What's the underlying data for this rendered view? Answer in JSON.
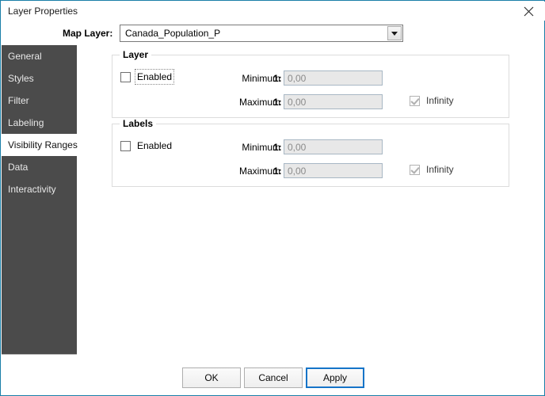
{
  "window": {
    "title": "Layer Properties",
    "close_icon": "close-icon",
    "border_color": "#1a7fa8"
  },
  "map_layer": {
    "label": "Map Layer:",
    "value": "Canada_Population_P",
    "placeholder": "Canada_Population_P",
    "dropdown_icon": "chevron-down-icon"
  },
  "sidebar": {
    "background_color": "#4b4b4b",
    "selected": "Visibility Ranges",
    "items": [
      {
        "label": "General",
        "selected": false
      },
      {
        "label": "Styles",
        "selected": false
      },
      {
        "label": "Filter",
        "selected": false
      },
      {
        "label": "Labeling",
        "selected": false
      },
      {
        "label": "Visibility Ranges",
        "selected": true
      },
      {
        "label": "Data",
        "selected": false
      },
      {
        "label": "Interactivity",
        "selected": false
      }
    ]
  },
  "groups": {
    "layer": {
      "title": "Layer",
      "enabled": {
        "label": "Enabled",
        "checked": false,
        "focused": true
      },
      "minimum": {
        "label": "Minimum",
        "prefix": "1:",
        "value": "0,00",
        "placeholder": "0,00",
        "disabled": true
      },
      "maximum": {
        "label": "Maximum",
        "prefix": "1:",
        "value": "0,00",
        "placeholder": "0,00",
        "disabled": true
      },
      "infinity": {
        "label": "Infinity",
        "checked": true,
        "disabled": true
      }
    },
    "labels": {
      "title": "Labels",
      "enabled": {
        "label": "Enabled",
        "checked": false,
        "focused": false
      },
      "minimum": {
        "label": "Minimum",
        "prefix": "1:",
        "value": "0,00",
        "placeholder": "0,00",
        "disabled": true
      },
      "maximum": {
        "label": "Maximum",
        "prefix": "1:",
        "value": "0,00",
        "placeholder": "0,00",
        "disabled": true
      },
      "infinity": {
        "label": "Infinity",
        "checked": true,
        "disabled": true
      }
    }
  },
  "footer": {
    "ok_label": "OK",
    "cancel_label": "Cancel",
    "apply_label": "Apply",
    "focused_button": "Apply",
    "focus_color": "#1674c8"
  }
}
